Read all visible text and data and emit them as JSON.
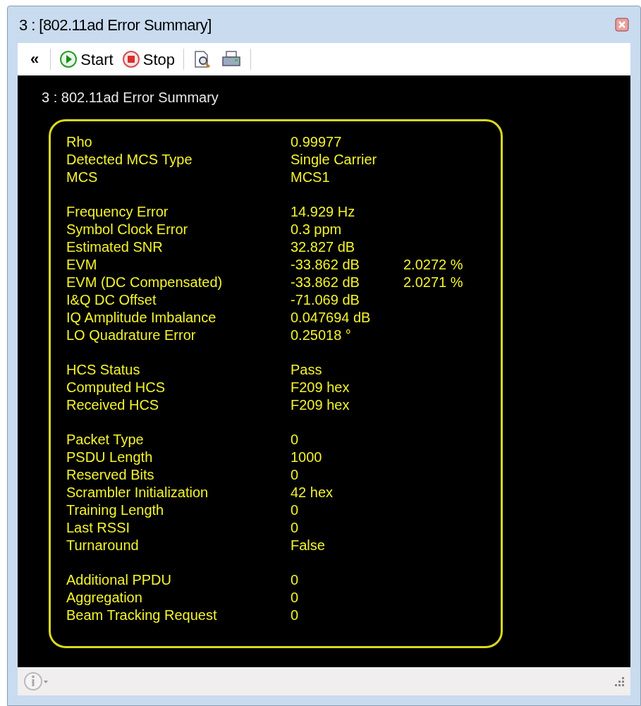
{
  "window": {
    "title": "3 : [802.11ad Error Summary]"
  },
  "toolbar": [
    {
      "kind": "collapse",
      "label": "«"
    },
    {
      "kind": "start",
      "label": "Start"
    },
    {
      "kind": "stop",
      "label": "Stop"
    },
    {
      "kind": "preview"
    },
    {
      "kind": "print"
    }
  ],
  "panel": {
    "title": "3 : 802.11ad Error Summary",
    "groups": [
      [
        {
          "label": "Rho",
          "value": "0.99977"
        },
        {
          "label": "Detected MCS Type",
          "value": "Single Carrier"
        },
        {
          "label": "MCS",
          "value": "MCS1"
        }
      ],
      [
        {
          "label": "Frequency Error",
          "value": "14.929 Hz"
        },
        {
          "label": "Symbol Clock Error",
          "value": "0.3 ppm"
        },
        {
          "label": "Estimated SNR",
          "value": "32.827 dB"
        },
        {
          "label": "EVM",
          "value": "-33.862 dB",
          "extra": "2.0272 %"
        },
        {
          "label": "EVM (DC Compensated)",
          "value": "-33.862 dB",
          "extra": "2.0271 %"
        },
        {
          "label": "I&Q DC Offset",
          "value": "-71.069 dB"
        },
        {
          "label": "IQ Amplitude Imbalance",
          "value": "0.047694 dB"
        },
        {
          "label": "LO Quadrature Error",
          "value": "0.25018 °"
        }
      ],
      [
        {
          "label": "HCS Status",
          "value": "Pass"
        },
        {
          "label": "Computed HCS",
          "value": "F209 hex"
        },
        {
          "label": "Received HCS",
          "value": "F209 hex"
        }
      ],
      [
        {
          "label": "Packet Type",
          "value": "0"
        },
        {
          "label": "PSDU Length",
          "value": "1000"
        },
        {
          "label": "Reserved Bits",
          "value": "0"
        },
        {
          "label": "Scrambler Initialization",
          "value": "42 hex"
        },
        {
          "label": "Training Length",
          "value": "0"
        },
        {
          "label": "Last RSSI",
          "value": "0"
        },
        {
          "label": "Turnaround",
          "value": "False"
        }
      ],
      [
        {
          "label": "Additional PPDU",
          "value": "0"
        },
        {
          "label": "Aggregation",
          "value": "0"
        },
        {
          "label": "Beam Tracking Request",
          "value": "0"
        }
      ]
    ]
  }
}
